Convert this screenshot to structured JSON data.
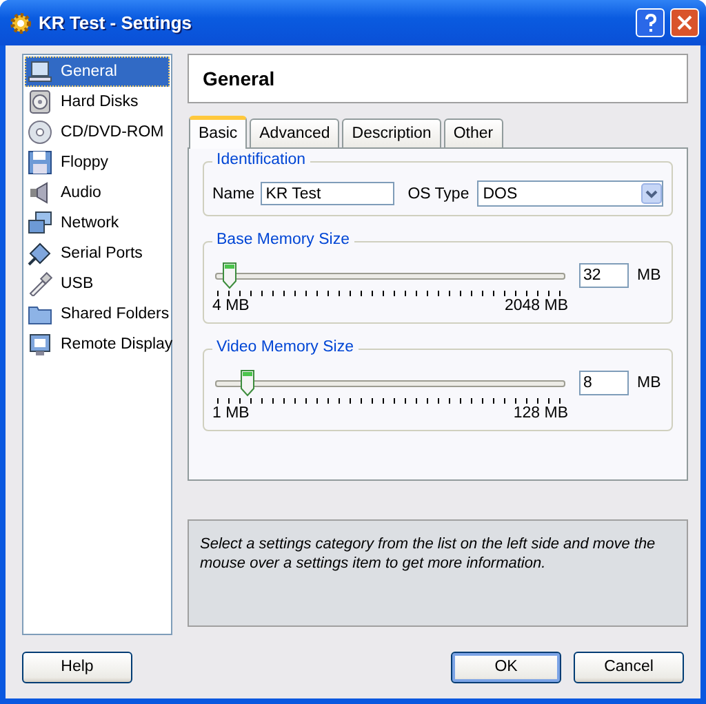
{
  "window": {
    "title": "KR Test - Settings"
  },
  "sidebar": {
    "items": [
      {
        "label": "General",
        "selected": true
      },
      {
        "label": "Hard Disks",
        "selected": false
      },
      {
        "label": "CD/DVD-ROM",
        "selected": false
      },
      {
        "label": "Floppy",
        "selected": false
      },
      {
        "label": "Audio",
        "selected": false
      },
      {
        "label": "Network",
        "selected": false
      },
      {
        "label": "Serial Ports",
        "selected": false
      },
      {
        "label": "USB",
        "selected": false
      },
      {
        "label": "Shared Folders",
        "selected": false
      },
      {
        "label": "Remote Display",
        "selected": false
      }
    ]
  },
  "page_title": "General",
  "tabs": [
    {
      "label": "Basic",
      "selected": true
    },
    {
      "label": "Advanced",
      "selected": false
    },
    {
      "label": "Description",
      "selected": false
    },
    {
      "label": "Other",
      "selected": false
    }
  ],
  "identification": {
    "title": "Identification",
    "name_label": "Name",
    "name_value": "KR Test",
    "os_label": "OS Type",
    "os_value": "DOS"
  },
  "memory": [
    {
      "title": "Base Memory Size",
      "level": 0.03,
      "value": "32",
      "unit": "MB",
      "min": "4 MB",
      "max": "2048 MB"
    },
    {
      "title": "Video Memory Size",
      "level": 0.08,
      "value": "8",
      "unit": "MB",
      "min": "1 MB",
      "max": "128 MB"
    }
  ],
  "info": "Select a settings category from the list on the left side and move the mouse over a settings item to get more information.",
  "buttons": [
    {
      "label": "Help",
      "default": false
    },
    {
      "label": "OK",
      "default": true
    },
    {
      "label": "Cancel",
      "default": false
    }
  ]
}
